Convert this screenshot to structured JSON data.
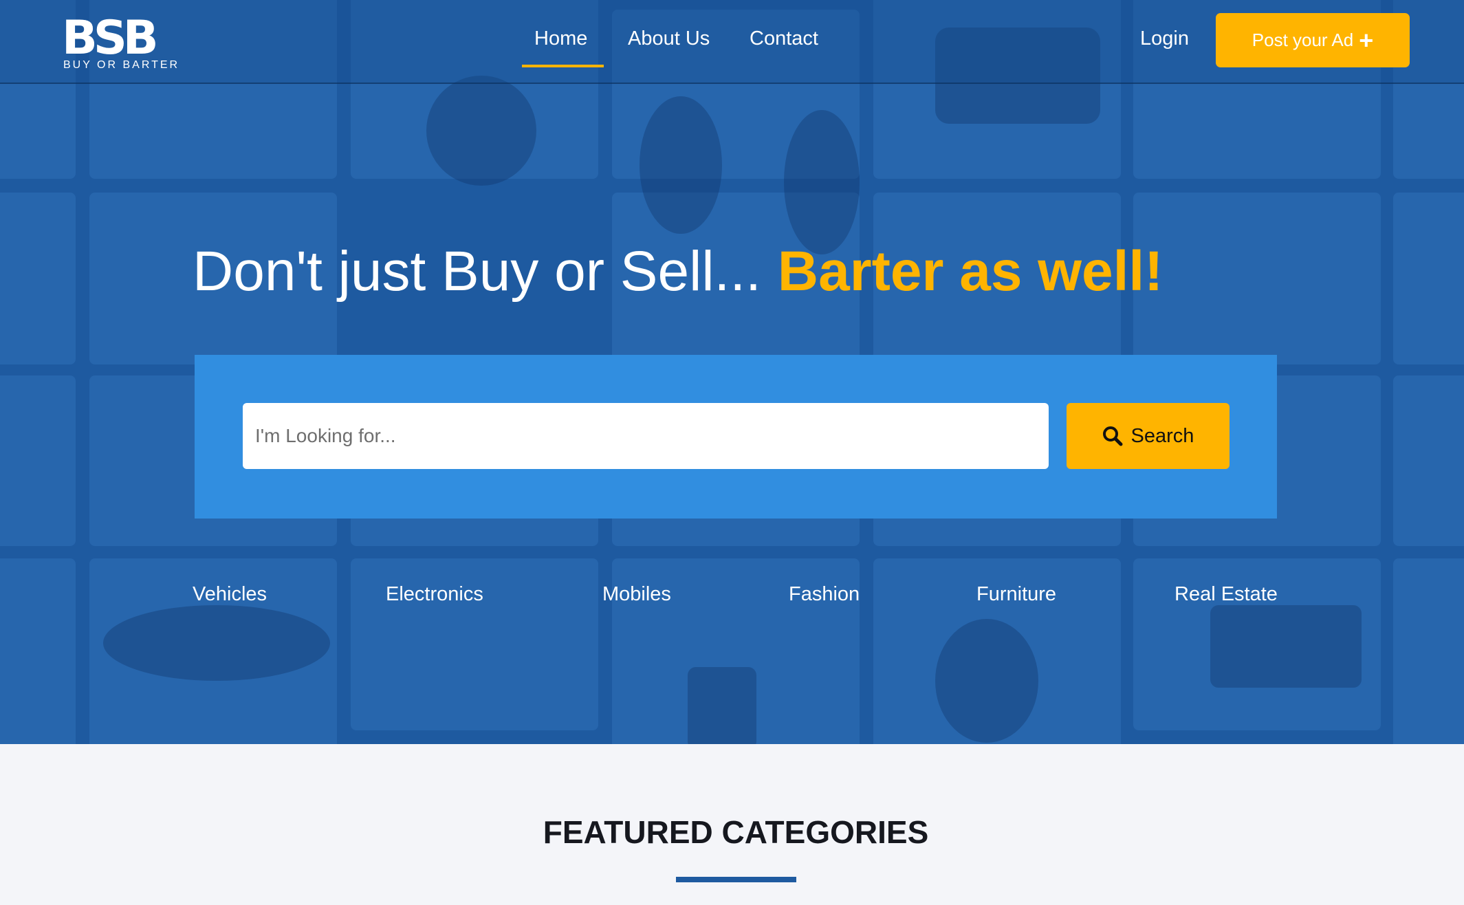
{
  "header": {
    "logo_mark": "BSB",
    "logo_text": "BUY OR BARTER",
    "nav": [
      "Home",
      "About Us",
      "Contact"
    ],
    "active_nav": "Home",
    "login_label": "Login",
    "post_ad_label": "Post your Ad"
  },
  "hero": {
    "headline_plain": "Don't just Buy or Sell...",
    "headline_accent": "Barter as well!"
  },
  "search": {
    "placeholder": "I'm Looking for...",
    "value": "",
    "button_label": "Search"
  },
  "categories": [
    "Vehicles",
    "Electronics",
    "Mobiles",
    "Fashion",
    "Furniture",
    "Real Estate"
  ],
  "featured": {
    "title": "FEATURED CATEGORIES"
  },
  "colors": {
    "brand_blue": "#1e5aa0",
    "search_panel": "#318ee0",
    "accent_yellow": "#ffb400",
    "section_bg": "#f4f5f9"
  }
}
